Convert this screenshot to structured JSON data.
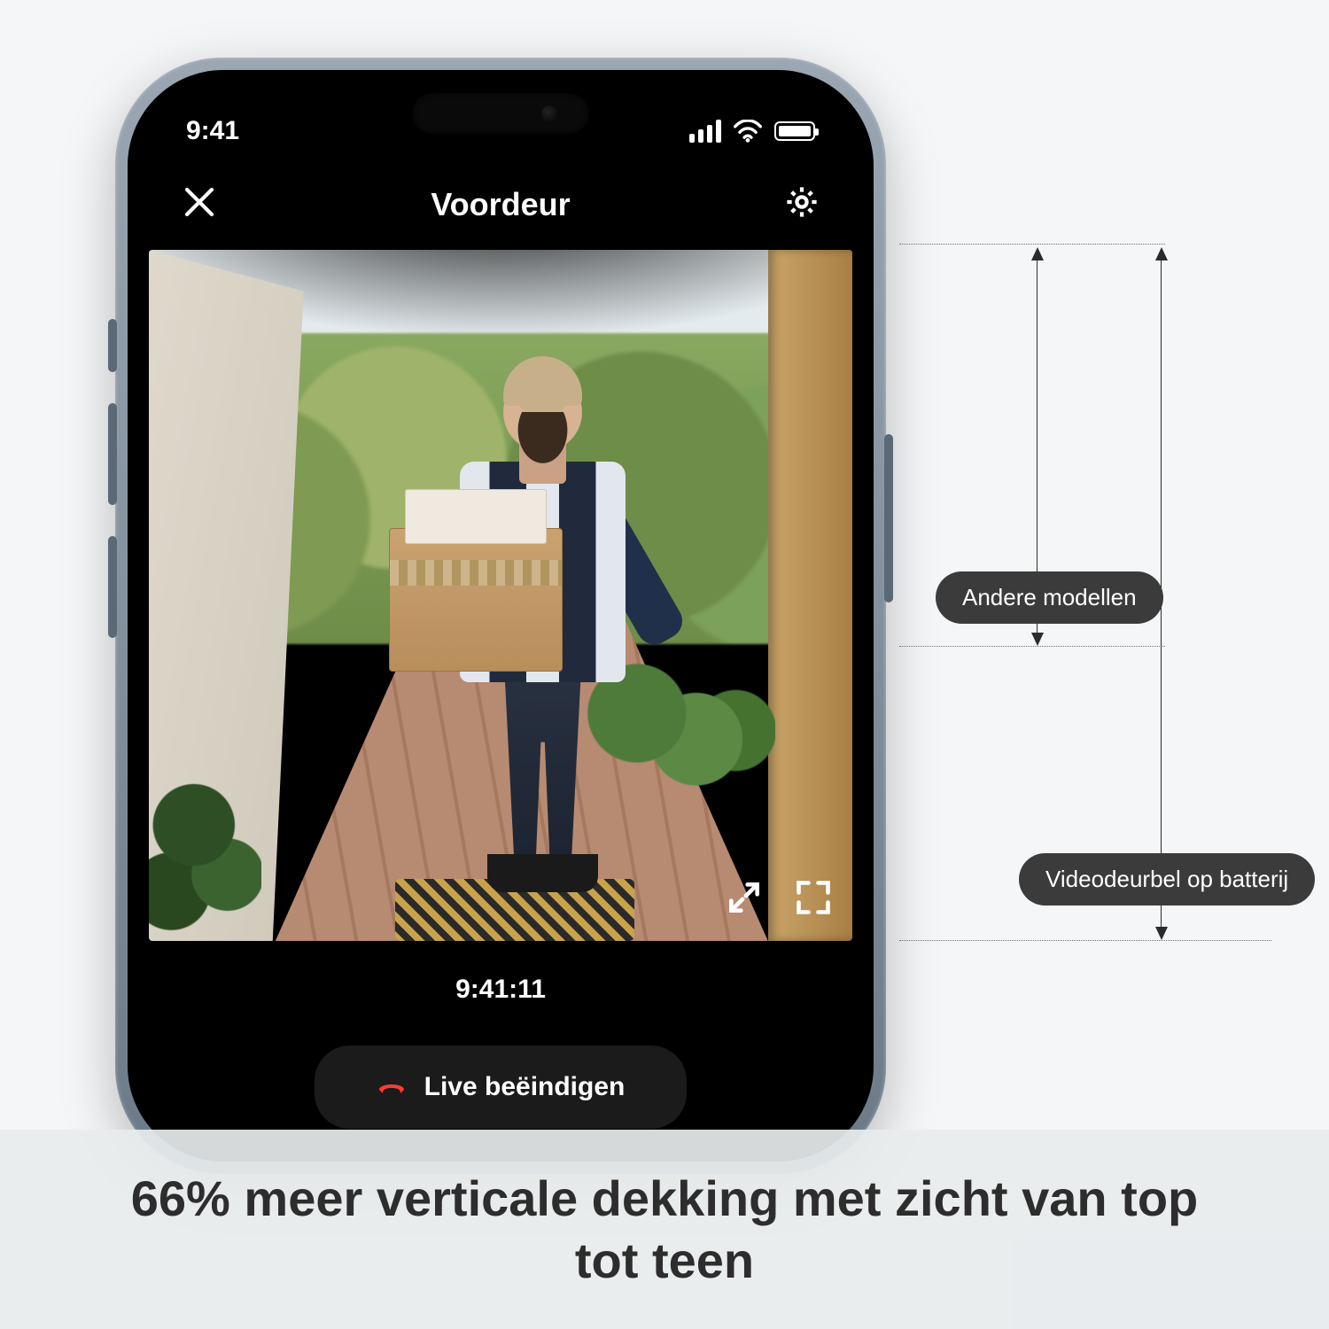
{
  "statusbar": {
    "time": "9:41"
  },
  "navbar": {
    "title": "Voordeur",
    "close_icon": "close-icon",
    "settings_icon": "gear-icon"
  },
  "feed": {
    "timestamp": "9:41:11",
    "expand_arrows_icon": "expand-arrows-icon",
    "fullscreen_icon": "fullscreen-icon"
  },
  "controls": {
    "end_live_label": "Live beëindigen",
    "hangup_icon": "hangup-icon"
  },
  "comparison": {
    "label_other": "Andere modellen",
    "label_product": "Videodeurbel op batterij"
  },
  "headline": "66% meer verticale dekking met zicht van top tot teen"
}
